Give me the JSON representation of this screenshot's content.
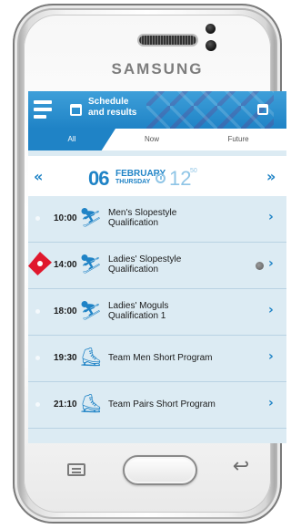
{
  "device": {
    "brand": "SAMSUNG"
  },
  "app": {
    "title_line1": "Schedule",
    "title_line2": "and results"
  },
  "tabs": [
    {
      "label": "All",
      "selected": true
    },
    {
      "label": "Now",
      "selected": false
    },
    {
      "label": "Future",
      "selected": false
    }
  ],
  "date_bar": {
    "prev": "«",
    "next": "»",
    "day": "06",
    "month": "FEBRUARY",
    "weekday": "THURSDAY",
    "time_hours": "12",
    "time_minutes": "50"
  },
  "events": [
    {
      "time": "10:00",
      "title_line1": "Men's Slopestyle",
      "title_line2": "Qualification",
      "sport_icon": "snowboard-icon",
      "highlighted": false
    },
    {
      "time": "14:00",
      "title_line1": "Ladies' Slopestyle",
      "title_line2": "Qualification",
      "sport_icon": "snowboard-icon",
      "highlighted": true,
      "live": true
    },
    {
      "time": "18:00",
      "title_line1": "Ladies' Moguls",
      "title_line2": "Qualification 1",
      "sport_icon": "freestyle-skiing-icon",
      "highlighted": false
    },
    {
      "time": "19:30",
      "title_line1": "Team Men Short Program",
      "title_line2": "",
      "sport_icon": "figure-skating-icon",
      "highlighted": false
    },
    {
      "time": "21:10",
      "title_line1": "Team Pairs Short Program",
      "title_line2": "",
      "sport_icon": "figure-skating-icon",
      "highlighted": false
    }
  ],
  "colors": {
    "accent": "#1f83c6",
    "row_bg": "#dcebf3",
    "flag": "#e0182d"
  }
}
